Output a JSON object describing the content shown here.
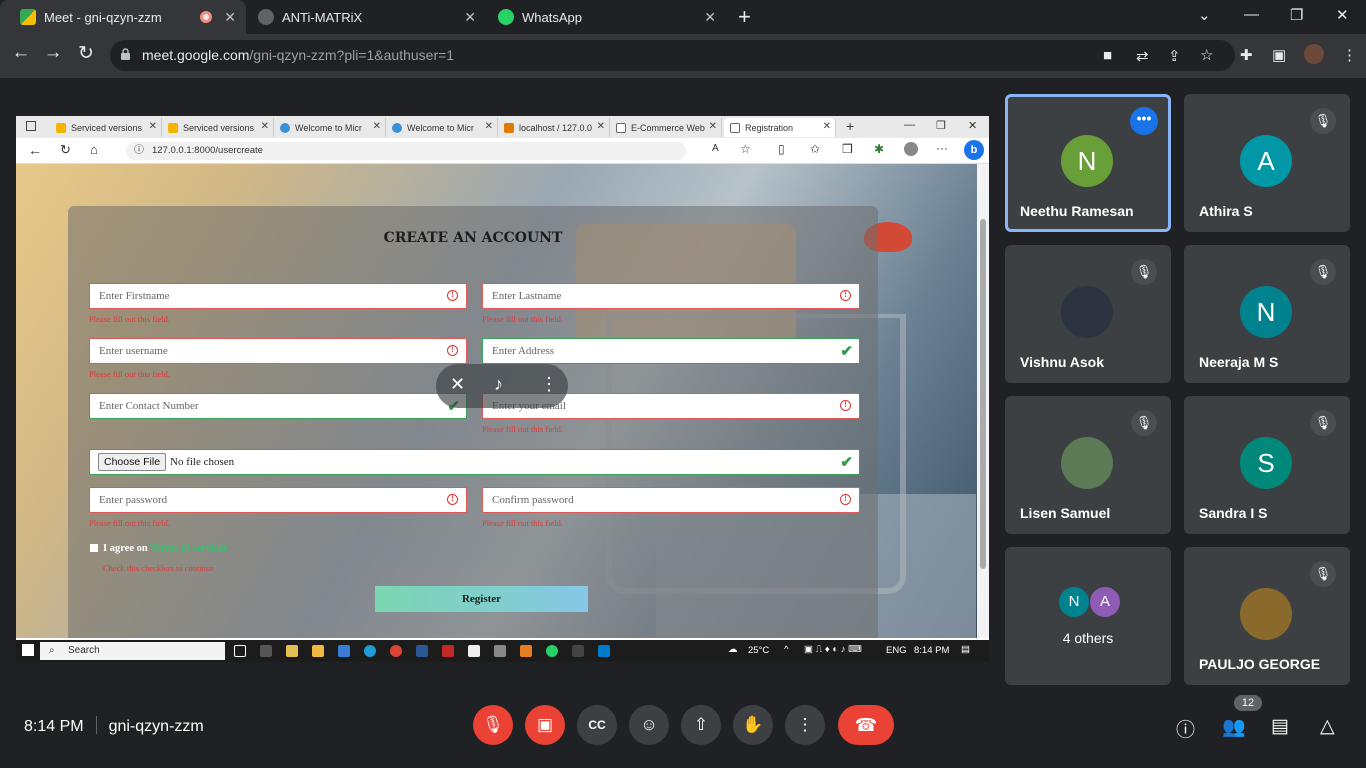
{
  "chrome": {
    "tabs": [
      {
        "title": "Meet - gni-qzyn-zzm",
        "active": true
      },
      {
        "title": "ANTi-MATRiX",
        "active": false
      },
      {
        "title": "WhatsApp",
        "active": false
      }
    ],
    "url_host": "meet.google.com",
    "url_path": "/gni-qzyn-zzm?pli=1&authuser=1"
  },
  "shared_screen": {
    "edge_tabs": [
      "Serviced versions",
      "Serviced versions",
      "Welcome to Micr",
      "Welcome to Micr",
      "localhost / 127.0.0",
      "E-Commerce Web",
      "Registration"
    ],
    "edge_url": "127.0.0.1:8000/usercreate",
    "form": {
      "title": "CREATE AN ACCOUNT",
      "firstname_ph": "Enter Firstname",
      "lastname_ph": "Enter Lastname",
      "username_ph": "Enter username",
      "address_ph": "Enter Address",
      "contact_ph": "Enter Contact Number",
      "email_ph": "Enter your email",
      "file_button": "Choose File",
      "file_status": "No file chosen",
      "password_ph": "Enter password",
      "confirm_ph": "Confirm password",
      "error_msg": "Please fill out this field.",
      "agree_text": "I agree on",
      "agree_link": "Terms of services",
      "agree_error": "Check this checkbox to continue",
      "register_label": "Register"
    },
    "taskbar": {
      "search_ph": "Search",
      "weather": "25°C",
      "lang": "ENG",
      "time": "8:14 PM"
    }
  },
  "participants": [
    {
      "name": "Neethu Ramesan",
      "initial": "N",
      "color": "#689f38",
      "speaking": true
    },
    {
      "name": "Athira S",
      "initial": "A",
      "color": "#0097a7"
    },
    {
      "name": "Vishnu Asok",
      "initial": "",
      "color": "#2b3440"
    },
    {
      "name": "Neeraja M S",
      "initial": "N",
      "color": "#00838f"
    },
    {
      "name": "Lisen Samuel",
      "initial": "",
      "color": "#5b7a55"
    },
    {
      "name": "Sandra I S",
      "initial": "S",
      "color": "#00897b"
    },
    {
      "name": "4 others",
      "initial": ""
    },
    {
      "name": "PAULJO GEORGE",
      "initial": "",
      "color": "#8a6a2a"
    }
  ],
  "others_initials": [
    "N",
    "A"
  ],
  "meeting": {
    "time": "8:14 PM",
    "code": "gni-qzyn-zzm",
    "participant_count": "12"
  }
}
